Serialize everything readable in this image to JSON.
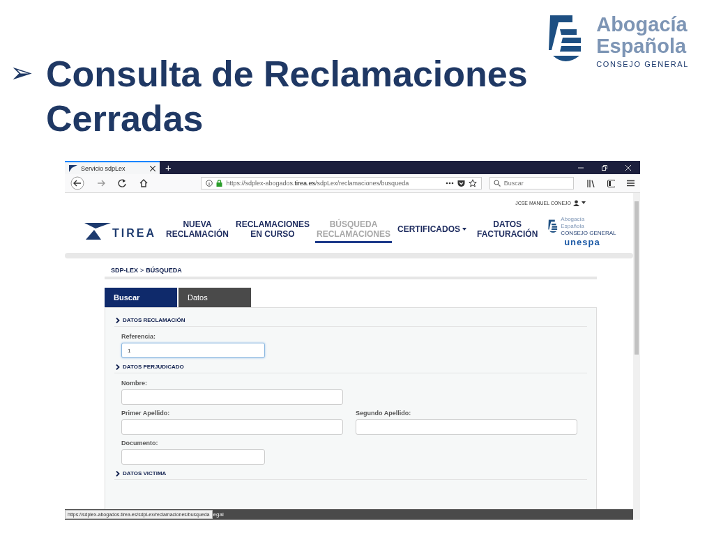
{
  "slide": {
    "bullet": "➢",
    "title_lines": [
      "Consulta de Reclamaciones",
      "Cerradas"
    ]
  },
  "logo": {
    "line1": "Abogacía",
    "line2": "Española",
    "subtitle": "CONSEJO GENERAL"
  },
  "browser": {
    "tab_title": "Servicio sdpLex",
    "new_tab": "+",
    "url_prefix": "https://sdplex-abogados.",
    "url_domain": "tirea.es",
    "url_path": "/sdpLex/reclamaciones/busqueda",
    "search_placeholder": "Buscar",
    "status_url": "https://sdplex-abogados.tirea.es/sdpLex/reclamaciones/busqueda",
    "footer_fragment": "egal"
  },
  "page": {
    "user": "JCSE MANUEL CONEJO",
    "brand": "TIREA",
    "nav": [
      {
        "lines": [
          "NUEVA",
          "RECLAMACIÓN"
        ],
        "selected": false,
        "dropdown": false
      },
      {
        "lines": [
          "RECLAMACIONES",
          "EN CURSO"
        ],
        "selected": false,
        "dropdown": false
      },
      {
        "lines": [
          "BÚSQUEDA",
          "RECLAMACIONES"
        ],
        "selected": true,
        "dropdown": false
      },
      {
        "lines": [
          "CERTIFICADOS"
        ],
        "selected": false,
        "dropdown": true
      },
      {
        "lines": [
          "DATOS",
          "FACTURACIÓN"
        ],
        "selected": false,
        "dropdown": false
      }
    ],
    "partner_logo": {
      "line1": "Abogacía",
      "line2": "Española",
      "subtitle": "CONSEJO GENERAL",
      "second": "unespa"
    },
    "breadcrumb": {
      "root": "SDP-LEX",
      "separator": ">",
      "current": "BÚSQUEDA"
    },
    "tabs": [
      {
        "label": "Buscar",
        "selected": true
      },
      {
        "label": "Datos",
        "selected": false
      }
    ],
    "sections": [
      {
        "title": "DATOS RECLAMACIÓN",
        "rows": [
          [
            {
              "label": "Referencia:",
              "kind": "short",
              "value": "1",
              "focused": true
            }
          ]
        ]
      },
      {
        "title": "DATOS PERJUDICADO",
        "rows": [
          [
            {
              "label": "Nombre:",
              "kind": "wide",
              "focused": false
            }
          ],
          [
            {
              "label": "Primer Apellido:",
              "kind": "wide",
              "focused": false
            },
            {
              "label": "Segundo Apellido:",
              "kind": "wide",
              "focused": false
            }
          ],
          [
            {
              "label": "Documento:",
              "kind": "short",
              "focused": false
            }
          ]
        ]
      },
      {
        "title": "DATOS VICTIMA"
      }
    ]
  }
}
